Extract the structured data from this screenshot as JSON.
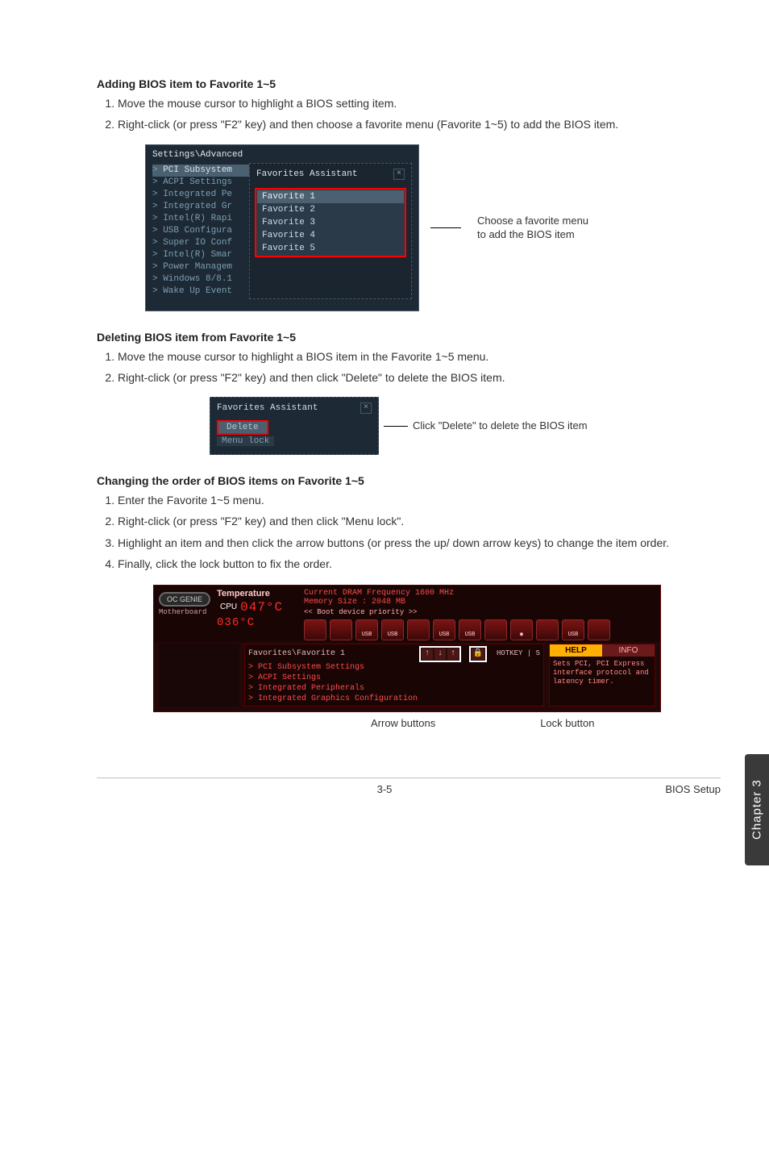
{
  "headings": {
    "add": "Adding BIOS item to Favorite 1~5",
    "del": "Deleting BIOS item from Favorite 1~5",
    "chg": "Changing the order of BIOS items on Favorite 1~5"
  },
  "add_steps": [
    "Move the mouse cursor to highlight a BIOS setting item.",
    "Right-click (or press \"F2\" key) and then choose a favorite menu (Favorite 1~5) to add the BIOS item."
  ],
  "del_steps": [
    "Move the mouse cursor to highlight a BIOS item in the Favorite 1~5 menu.",
    "Right-click (or press \"F2\" key) and then click \"Delete\" to delete the BIOS item."
  ],
  "chg_steps": [
    "Enter the Favorite 1~5 menu.",
    "Right-click (or press \"F2\" key) and then click \"Menu lock\".",
    "Highlight an item and then click the arrow buttons (or press the up/ down arrow keys) to change the item order.",
    "Finally, click the lock button to fix the order."
  ],
  "fig1": {
    "crumb": "Settings\\Advanced",
    "left_items": [
      "PCI Subsystem",
      "ACPI Settings",
      "Integrated Pe",
      "Integrated Gr",
      "Intel(R) Rapi",
      "USB Configura",
      "Super IO Conf",
      "Intel(R) Smar",
      "Power Managem",
      "Windows 8/8.1",
      "Wake Up Event"
    ],
    "popup_title": "Favorites Assistant",
    "favs": [
      "Favorite 1",
      "Favorite 2",
      "Favorite 3",
      "Favorite 4",
      "Favorite 5"
    ],
    "annot1": "Choose a favorite menu",
    "annot2": "to add the BIOS item"
  },
  "fig2": {
    "title": "Favorites Assistant",
    "delete_label": "Delete",
    "menulock_label": "Menu lock",
    "annot": "Click \"Delete\" to delete the BIOS item"
  },
  "fig3": {
    "temp_label": "Temperature",
    "cpu_label": "CPU",
    "oc_genie": "OC GENIE",
    "mobo": "Motherboard",
    "temp_cpu": "047°C",
    "temp_mb": "036°C",
    "dram": "Current DRAM Frequency 1600 MHz",
    "mem": "Memory Size : 2048 MB",
    "boot_prio": "Boot device priority",
    "crumb": "Favorites\\Favorite 1",
    "items": [
      "PCI Subsystem Settings",
      "ACPI Settings",
      "Integrated Peripherals",
      "Integrated Graphics Configuration"
    ],
    "hotkey": "HOTKEY | 5",
    "help_tab1": "HELP",
    "help_tab2": "INFO",
    "help_text": "Sets PCI, PCI Express interface protocol and latency timer.",
    "annot_arrow": "Arrow buttons",
    "annot_lock": "Lock button"
  },
  "side_tab": "Chapter 3",
  "footer": {
    "page": "3-5",
    "section": "BIOS Setup"
  }
}
